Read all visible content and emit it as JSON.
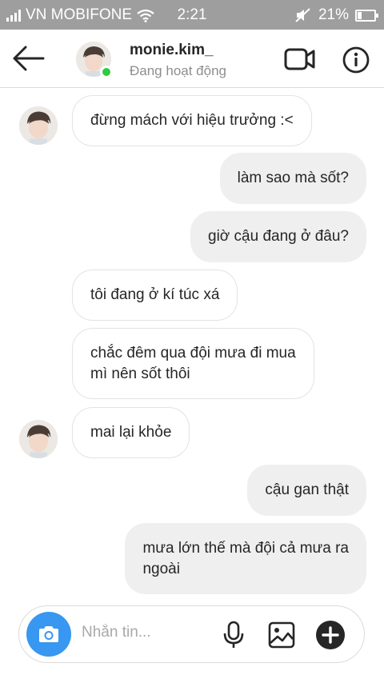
{
  "status_bar": {
    "carrier": "VN MOBIFONE",
    "time": "2:21",
    "battery": "21%",
    "icons": [
      "signal-icon",
      "wifi-icon",
      "mute-icon",
      "battery-icon"
    ]
  },
  "header": {
    "username": "monie.kim_",
    "status": "Đang hoạt động",
    "online_color": "#2ecc40",
    "icons": [
      "back-arrow-icon",
      "video-call-icon",
      "info-icon"
    ]
  },
  "messages": [
    {
      "side": "in",
      "lines": [
        "đừng mách với hiệu trưởng :<"
      ]
    },
    {
      "side": "out",
      "lines": [
        "làm sao mà sốt?"
      ]
    },
    {
      "side": "out",
      "lines": [
        "giờ cậu đang ở đâu?"
      ]
    },
    {
      "side": "in",
      "lines": [
        "tôi đang ở kí túc xá"
      ]
    },
    {
      "side": "in",
      "lines": [
        "chắc đêm qua đội mưa đi mua",
        "mì nên sốt thôi"
      ]
    },
    {
      "side": "in",
      "lines": [
        "mai lại khỏe"
      ]
    },
    {
      "side": "out",
      "lines": [
        "cậu gan thật"
      ]
    },
    {
      "side": "out",
      "lines": [
        "mưa lớn thế mà đội cả mưa ra",
        "ngoài"
      ]
    }
  ],
  "composer": {
    "placeholder": "Nhắn tin...",
    "accent_color": "#3897f0",
    "icons": [
      "camera-icon",
      "microphone-icon",
      "gallery-icon",
      "plus-icon"
    ]
  }
}
